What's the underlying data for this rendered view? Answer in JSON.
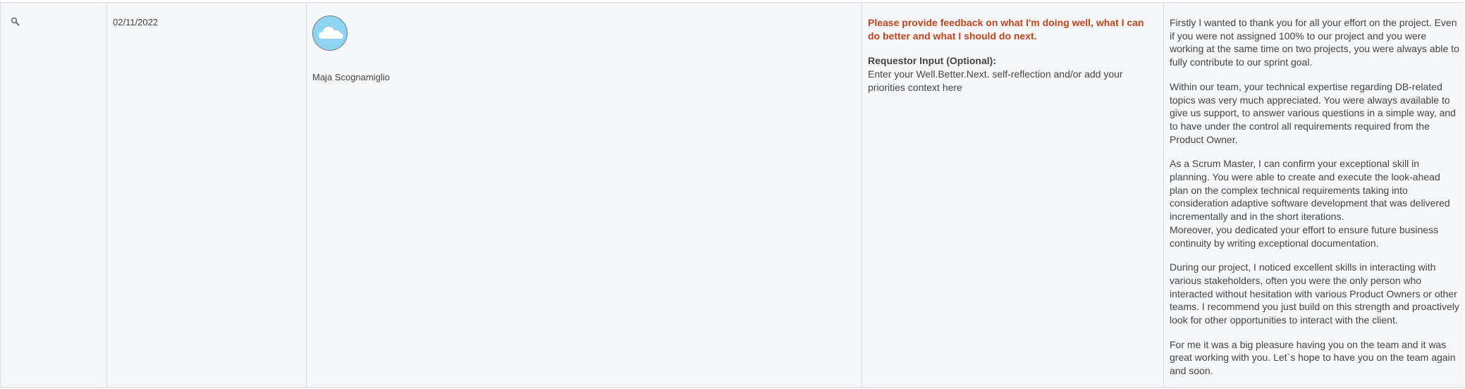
{
  "row": {
    "search_icon": "search-icon",
    "date": "02/11/2022",
    "avatar_icon": "cloud-icon",
    "requestor_name": "Maja Scognamiglio",
    "question": {
      "prompt": "Please provide feedback on what I'm doing well, what I can do better and what I should do next.",
      "input_label": "Requestor Input (Optional):",
      "input_text": "Enter your Well.Better.Next. self-reflection and/or add your priorities context here"
    },
    "answer": {
      "p1": "Firstly I wanted to thank you for all your effort on the project. Even if you were not assigned 100% to our project and you were working at the same time on two projects, you were always able to fully contribute to our sprint goal.",
      "p2": "Within our team, your technical expertise regarding DB-related topics was very much appreciated. You were always available to give us support, to answer various questions in a simple way, and to have under the control all requirements required from the Product Owner.",
      "p3a": "As a Scrum Master, I can confirm your exceptional skill in planning. You were able to create and execute the look-ahead plan on the complex technical requirements taking into consideration adaptive software development that was delivered incrementally and in the short iterations.",
      "p3b": "Moreover, you dedicated your effort to ensure future business continuity by writing exceptional documentation.",
      "p4": "During our project, I noticed excellent skills in interacting with various stakeholders, often you were the only person who interacted without hesitation with various Product Owners or other teams. I recommend you just build on this strength and proactively look for other opportunities to interact with the client.",
      "p5": "For me it was a big pleasure having you on the team and it was great working with you. Let`s hope to have you on the team again and soon."
    }
  },
  "colors": {
    "prompt": "#c0441c",
    "row_bg": "#f6f7f9",
    "border": "#d9dce0",
    "avatar_bg": "#8fd3f0"
  }
}
